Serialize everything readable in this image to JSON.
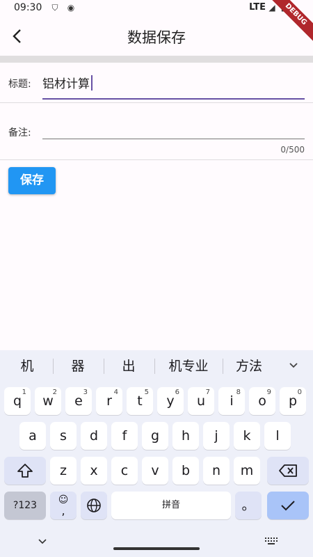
{
  "status": {
    "time": "09:30",
    "network": "LTE",
    "debug_banner": "DEBUG"
  },
  "appbar": {
    "title": "数据保存",
    "back_glyph": "<"
  },
  "form": {
    "title_label": "标题:",
    "title_value": "铝材计算",
    "note_label": "备注:",
    "note_value": "",
    "note_counter": "0/500",
    "save_label": "保存"
  },
  "keyboard": {
    "candidates": [
      "机",
      "器",
      "出",
      "机专业",
      "方法"
    ],
    "row1": [
      {
        "k": "q",
        "n": "1"
      },
      {
        "k": "w",
        "n": "2"
      },
      {
        "k": "e",
        "n": "3"
      },
      {
        "k": "r",
        "n": "4"
      },
      {
        "k": "t",
        "n": "5"
      },
      {
        "k": "y",
        "n": "6"
      },
      {
        "k": "u",
        "n": "7"
      },
      {
        "k": "i",
        "n": "8"
      },
      {
        "k": "o",
        "n": "9"
      },
      {
        "k": "p",
        "n": "0"
      }
    ],
    "row2": [
      "a",
      "s",
      "d",
      "f",
      "g",
      "h",
      "j",
      "k",
      "l"
    ],
    "row3": [
      "z",
      "x",
      "c",
      "v",
      "b",
      "n",
      "m"
    ],
    "symbols_label": "?123",
    "emoji_label": "☺",
    "comma_label": ",",
    "space_label": "拼音",
    "period_label": "。"
  },
  "colors": {
    "accent": "#6750a4",
    "save_button": "#2196f3",
    "enter_key": "#a9c4f8"
  }
}
